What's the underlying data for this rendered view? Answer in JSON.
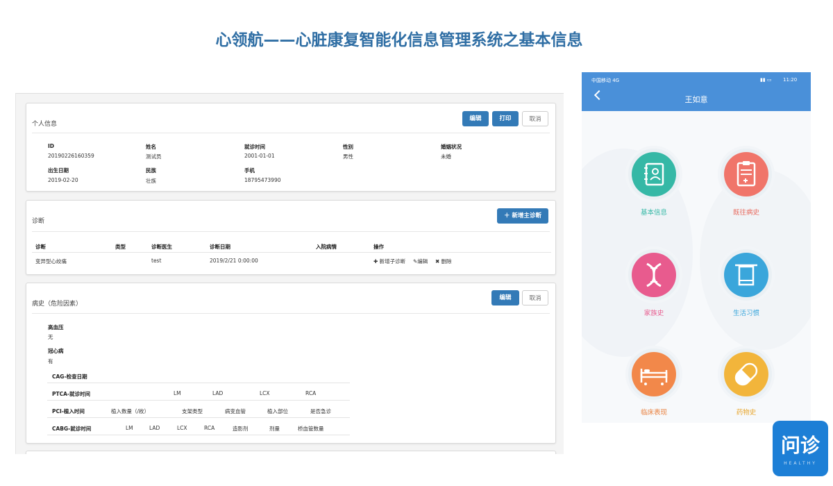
{
  "page_title": "心领航——心脏康复智能化信息管理系统之基本信息",
  "personal": {
    "title": "个人信息",
    "edit": "编辑",
    "print": "打印",
    "cancel": "取消",
    "fields": [
      {
        "label": "ID",
        "value": "20190226160359"
      },
      {
        "label": "姓名",
        "value": "测试员"
      },
      {
        "label": "就诊时间",
        "value": "2001-01-01"
      },
      {
        "label": "性别",
        "value": "男性"
      },
      {
        "label": "婚姻状况",
        "value": "未婚"
      },
      {
        "label": "出生日期",
        "value": "2019-02-20"
      },
      {
        "label": "民族",
        "value": "壮族"
      },
      {
        "label": "手机",
        "value": "18795473990"
      }
    ]
  },
  "diagnosis": {
    "title": "诊断",
    "add_button": "新增主诊断",
    "columns": [
      "诊断",
      "类型",
      "诊断医生",
      "诊断日期",
      "入院病情",
      "操作"
    ],
    "row": {
      "diagnosis": "变异型心绞痛",
      "type": "",
      "doctor": "test",
      "date": "2019/2/21 0:00:00",
      "condition": ""
    },
    "actions": {
      "add_sub": "新增子诊断",
      "edit": "编辑",
      "delete": "删除"
    }
  },
  "history": {
    "title": "病史（危险因素）",
    "edit": "编辑",
    "cancel": "取消",
    "hypertension_label": "高血压",
    "hypertension_value": "无",
    "chd_label": "冠心病",
    "chd_value": "有",
    "cag_label": "CAG-检查日期",
    "ptca": {
      "label": "PTCA-就诊时间",
      "cols": [
        "LM",
        "LAD",
        "LCX",
        "RCA"
      ]
    },
    "pci": {
      "label": "PCI-植入时间",
      "cols": [
        "植入数量（/枚）",
        "支架类型",
        "病变血管",
        "植入部位",
        "是否急诊"
      ]
    },
    "cabg": {
      "label": "CABG-就诊时间",
      "cols": [
        "LM",
        "LAD",
        "LCX",
        "RCA",
        "造影剂",
        "剂量",
        "桥血管数量"
      ]
    }
  },
  "phone": {
    "carrier": "中国移动 4G",
    "time": "11:20",
    "header_title": "王如意",
    "tiles": [
      {
        "label": "基本信息",
        "color": "#35b8a6",
        "text_color": "#35b8a6",
        "icon": "contact-book-icon"
      },
      {
        "label": "既往病史",
        "color": "#f0756a",
        "text_color": "#e8685c",
        "icon": "clipboard-icon"
      },
      {
        "label": "家族史",
        "color": "#e85b8e",
        "text_color": "#e85b8e",
        "icon": "dna-icon"
      },
      {
        "label": "生活习惯",
        "color": "#3aa6db",
        "text_color": "#3aa6db",
        "icon": "towel-icon"
      },
      {
        "label": "临床表现",
        "color": "#f2884a",
        "text_color": "#e9803e",
        "icon": "hospital-bed-icon"
      },
      {
        "label": "药物史",
        "color": "#f2b53b",
        "text_color": "#e8a52a",
        "icon": "pill-icon"
      }
    ]
  },
  "logo": {
    "text": "问诊",
    "sub": "HEALTHY"
  }
}
